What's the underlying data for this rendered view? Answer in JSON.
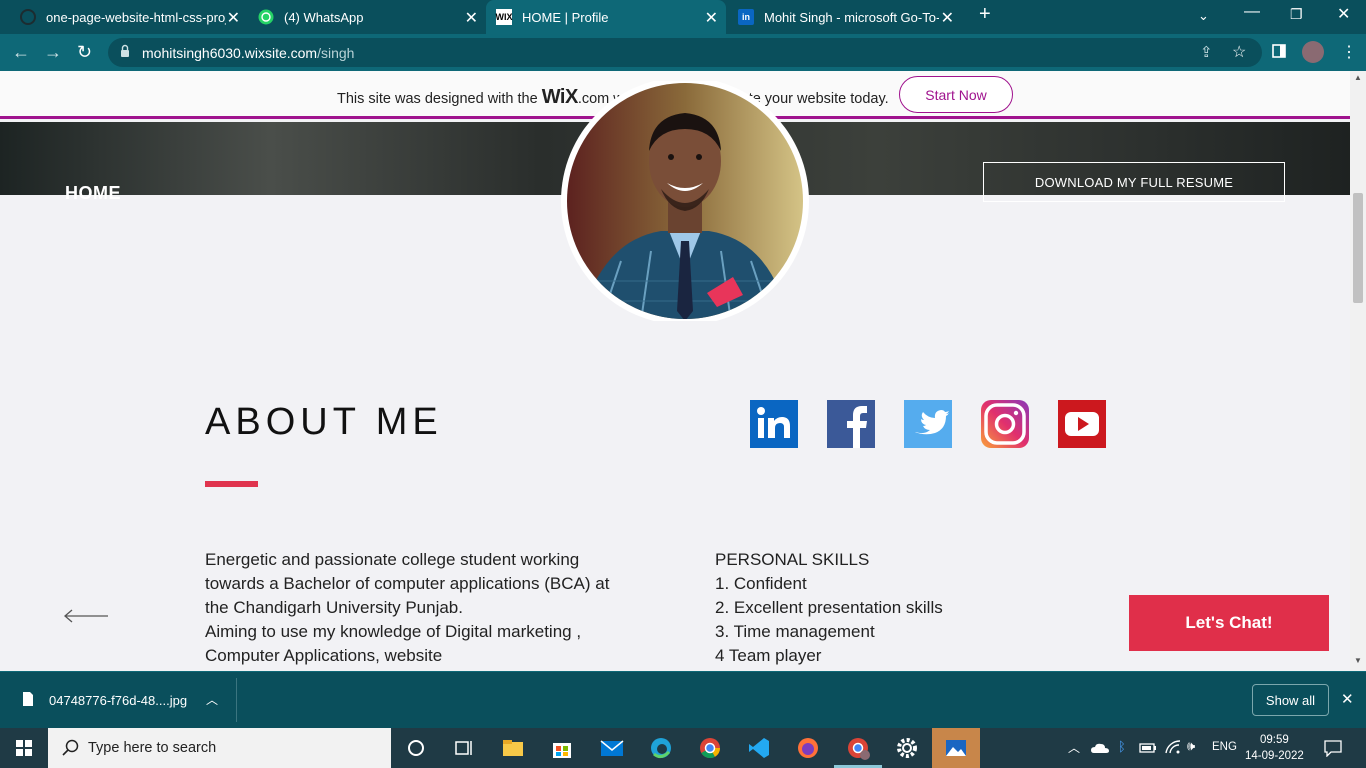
{
  "browser": {
    "tabs": [
      {
        "title": "one-page-website-html-css-proj",
        "favicon": "github-icon"
      },
      {
        "title": "(4) WhatsApp",
        "favicon": "whatsapp-icon"
      },
      {
        "title": "HOME | Profile",
        "favicon": "wix-icon",
        "favicon_text": "WIX"
      },
      {
        "title": "Mohit Singh - microsoft Go-To-M",
        "favicon": "linkedin-icon",
        "favicon_text": "in"
      }
    ],
    "url_host": "mohitsingh6030.wixsite.com",
    "url_path": "/singh"
  },
  "banner": {
    "text_before": "This site was designed with the",
    "wix_logo": "WiX",
    "text_after": ".com website builder. Create your website today.",
    "start_now": "Start Now"
  },
  "header": {
    "home": "HOME",
    "resume_button": "DOWNLOAD MY FULL RESUME"
  },
  "about": {
    "title": "ABOUT ME",
    "bio_lines": [
      "Energetic and passionate college student working",
      "towards a Bachelor of computer applications (BCA) at",
      "the Chandigarh University Punjab.",
      "Aiming to use my knowledge of Digital marketing ,",
      "Computer Applications, website"
    ],
    "skills_title": "PERSONAL SKILLS",
    "skills": [
      "1. Confident",
      "2. Excellent presentation skills",
      "3. Time management",
      "4 Team player"
    ]
  },
  "social": [
    {
      "name": "linkedin-icon",
      "color": "#0a66c2"
    },
    {
      "name": "facebook-icon",
      "color": "#3b5998"
    },
    {
      "name": "twitter-icon",
      "color": "#55acee"
    },
    {
      "name": "instagram-icon",
      "color": "#c13584"
    },
    {
      "name": "youtube-icon",
      "color": "#cc181e"
    }
  ],
  "chat_button": "Let's Chat!",
  "download_bar": {
    "file_name": "04748776-f76d-48....jpg",
    "show_all": "Show all"
  },
  "taskbar": {
    "search_placeholder": "Type here to search",
    "language": "ENG",
    "time": "09:59",
    "date": "14-09-2022"
  },
  "colors": {
    "accent": "#e0344e",
    "wix_purple": "#a0138e",
    "browser_frame": "#0e6877"
  }
}
